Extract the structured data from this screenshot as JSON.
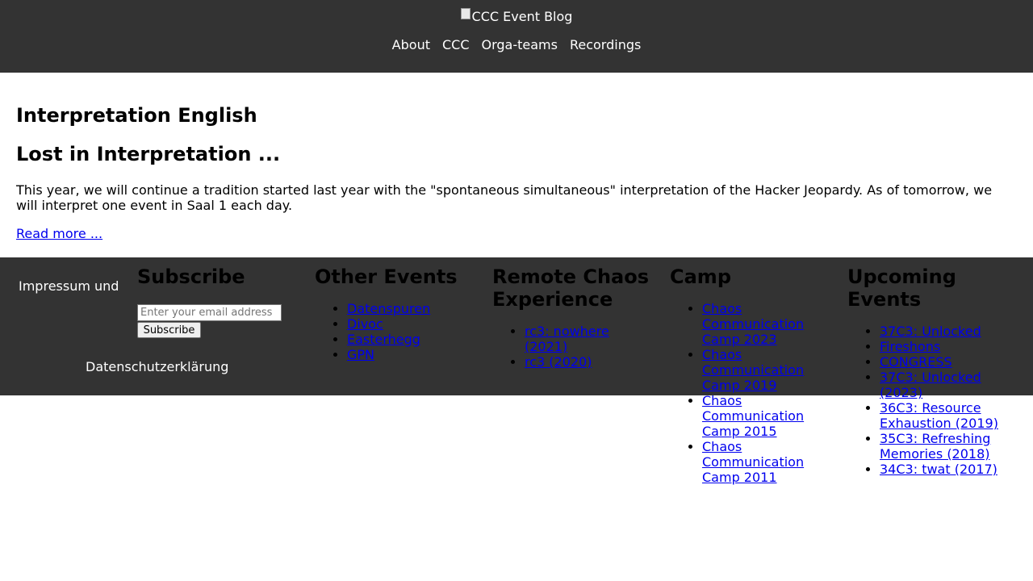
{
  "header": {
    "logo_alt": "CCC Event Blog",
    "nav": [
      "About",
      "CCC",
      "Orga-teams",
      "Recordings"
    ]
  },
  "main": {
    "section_title": "Interpretation English",
    "post_title": "Lost in Interpretation ...",
    "post_excerpt": "This year, we will continue a tradition started last year with the \"spontaneous simultaneous\" interpretation of the Hacker Jeopardy. As of tomorrow, we will interpret one event in Saal 1 each day.",
    "read_more": "Read more ..."
  },
  "footer": {
    "legal": {
      "imprint": "Impressum und",
      "privacy": "Datenschutzerklärung"
    },
    "subscribe": {
      "title": "Subscribe",
      "email_placeholder": "Enter your email address",
      "button_label": "Subscribe"
    },
    "other_events": {
      "title": "Other Events",
      "items": [
        "Datenspuren",
        "Divoc",
        "Easterhegg",
        "GPN"
      ]
    },
    "remote_chaos": {
      "title": "Remote Chaos Experience",
      "items": [
        "rc3: nowhere (2021)",
        "rc3 (2020)"
      ]
    },
    "camp": {
      "title": "Camp",
      "items": [
        "Chaos Communication Camp 2023",
        "Chaos Communication Camp 2019",
        "Chaos Communication Camp 2015",
        "Chaos Communication Camp 2011"
      ]
    },
    "upcoming": {
      "title": "Upcoming Events",
      "items": [
        "37C3: Unlocked",
        "Fireshons",
        "CONGRESS",
        "37C3: Unlocked (2023)",
        "36C3: Resource Exhaustion (2019)",
        "35C3: Refreshing Memories (2018)",
        "34C3: twat (2017)"
      ]
    }
  }
}
